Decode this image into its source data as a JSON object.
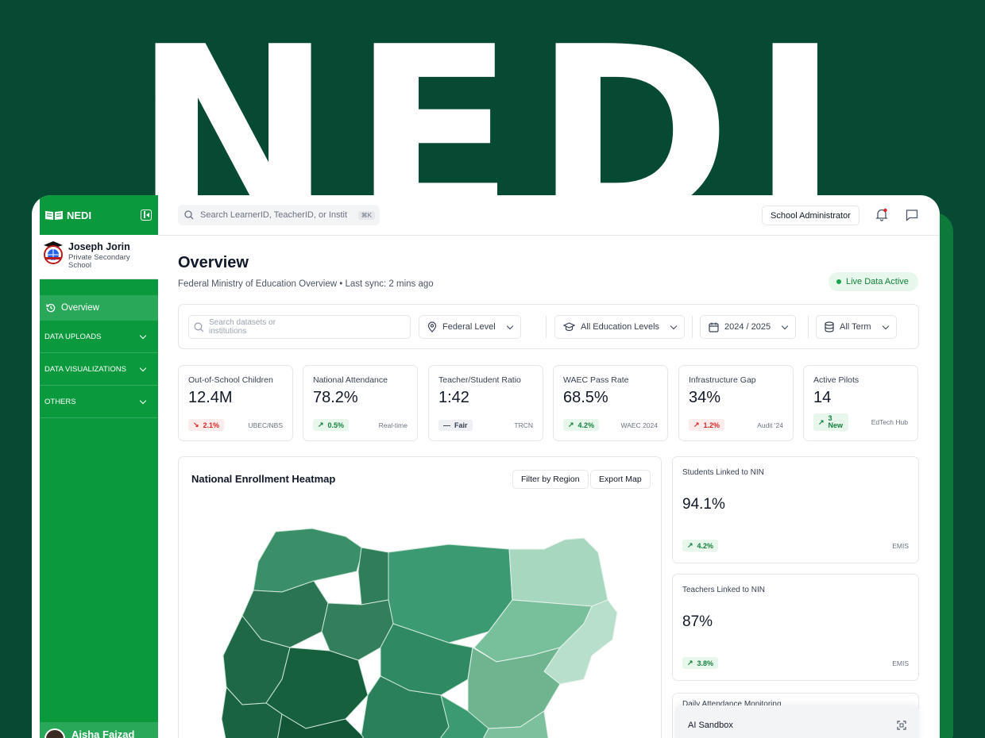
{
  "hero": {
    "wordmark": "NEDI"
  },
  "brand": {
    "logo_text": "NEDI",
    "primary": "#0a9a3d",
    "dark_bg": "#074a33",
    "up": "#15803d",
    "down": "#dc2626"
  },
  "profile": {
    "name": "Joseph Jorin",
    "role": "Private Secondary School"
  },
  "sidebar": {
    "active": "Overview",
    "groups": [
      "DATA UPLOADS",
      "DATA VISUALIZATIONS",
      "OTHERS"
    ],
    "user": "Aisha Faizad"
  },
  "topbar": {
    "search_placeholder": "Search LearnerID, TeacherID, or Instit",
    "shortcut": "⌘K",
    "role_button": "School Administrator"
  },
  "overview": {
    "title": "Overview",
    "subtitle": "Federal Ministry of Education Overview • Last sync: 2 mins ago",
    "live_badge": "Live Data Active"
  },
  "filters": {
    "search_placeholder": "Search datasets or institutions",
    "level": "Federal Level",
    "education": "All Education Levels",
    "year": "2024 / 2025",
    "term": "All Term"
  },
  "kpis": [
    {
      "label": "Out-of-School Children",
      "value": "12.4M",
      "change": "2.1%",
      "dir": "down",
      "source": "UBEC/NBS"
    },
    {
      "label": "National Attendance",
      "value": "78.2%",
      "change": "0.5%",
      "dir": "up",
      "source": "Real-time"
    },
    {
      "label": "Teacher/Student Ratio",
      "value": "1:42",
      "change": "Fair",
      "dir": "neutral",
      "source": "TRCN"
    },
    {
      "label": "WAEC Pass Rate",
      "value": "68.5%",
      "change": "4.2%",
      "dir": "up",
      "source": "WAEC 2024"
    },
    {
      "label": "Infrastructure Gap",
      "value": "34%",
      "change": "1.2%",
      "dir": "down",
      "source": "Audit '24"
    },
    {
      "label": "Active Pilots",
      "value": "14",
      "change": "3 New",
      "dir": "up",
      "source": "EdTech Hub"
    }
  ],
  "heatmap": {
    "title": "National Enrollment Heatmap",
    "filter_button": "Filter by Region",
    "export_button": "Export Map"
  },
  "stats": [
    {
      "label": "Students Linked to NIN",
      "value": "94.1%",
      "change": "4.2%",
      "source": "EMIS"
    },
    {
      "label": "Teachers Linked to NIN",
      "value": "87%",
      "change": "3.8%",
      "source": "EMIS"
    }
  ],
  "attendance": {
    "label": "Daily Attendance Monitoring"
  },
  "sandbox": {
    "label": "AI Sandbox"
  }
}
